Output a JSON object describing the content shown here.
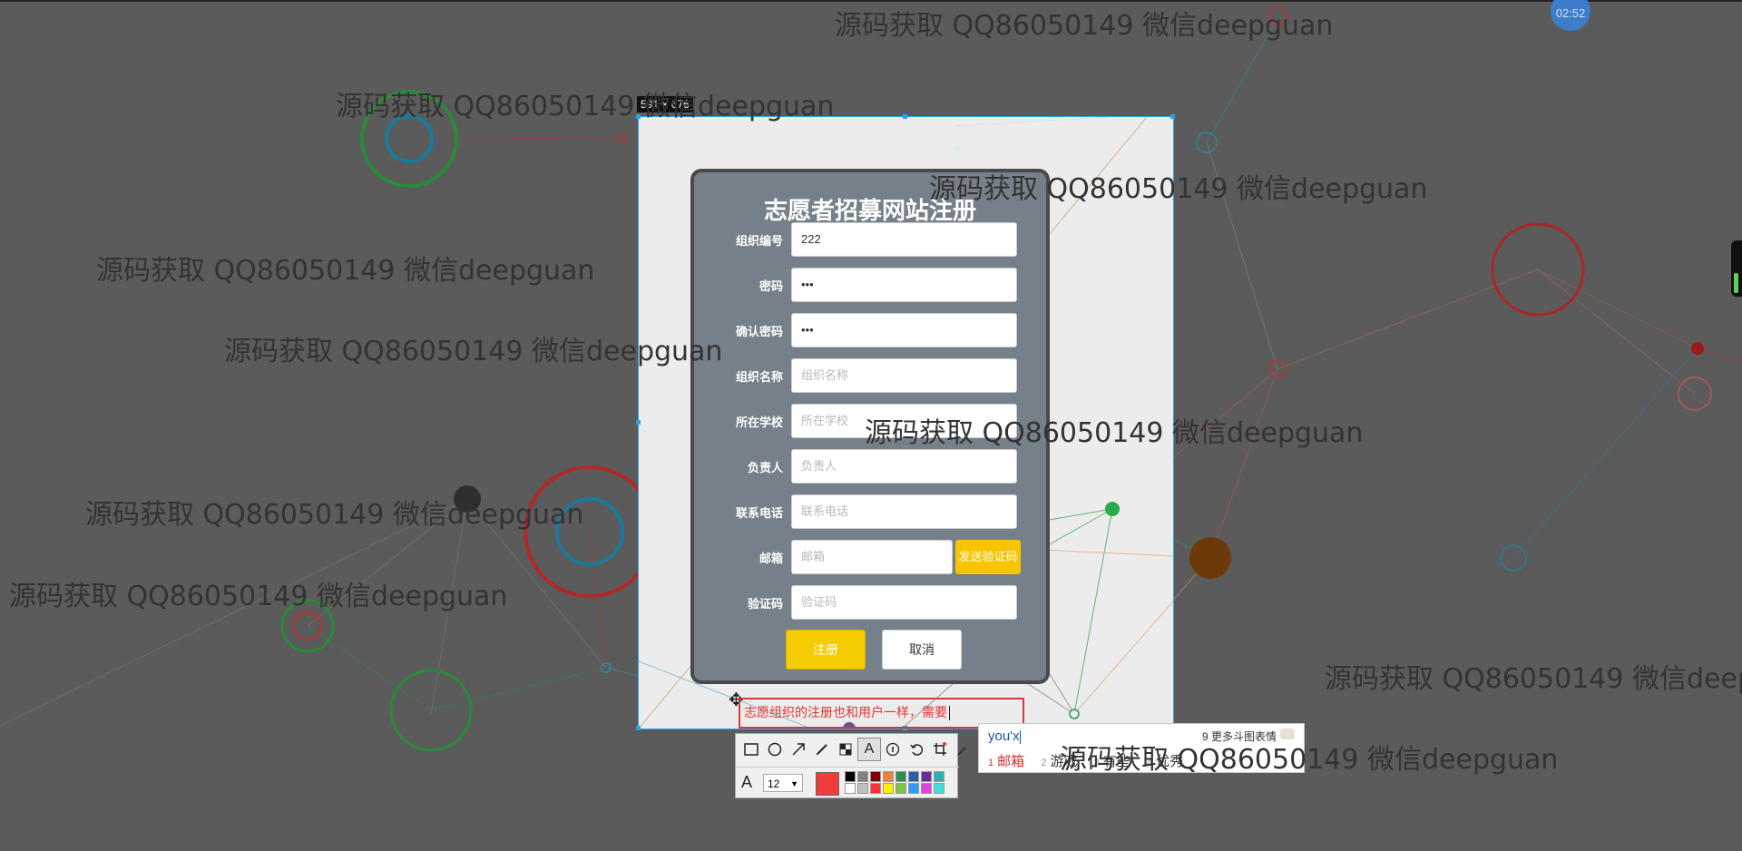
{
  "watermark_text": "源码获取 QQ86050149 微信deepguan",
  "timer": "02:52",
  "capture": {
    "dimensions_label": "591 × 676"
  },
  "form": {
    "title": "志愿者招募网站注册",
    "fields": [
      {
        "label": "组织编号",
        "value": "222",
        "placeholder": ""
      },
      {
        "label": "密码",
        "value": "•••",
        "placeholder": ""
      },
      {
        "label": "确认密码",
        "value": "•••",
        "placeholder": ""
      },
      {
        "label": "组织名称",
        "value": "",
        "placeholder": "组织名称"
      },
      {
        "label": "所在学校",
        "value": "",
        "placeholder": "所在学校"
      },
      {
        "label": "负责人",
        "value": "",
        "placeholder": "负责人"
      },
      {
        "label": "联系电话",
        "value": "",
        "placeholder": "联系电话"
      },
      {
        "label": "邮箱",
        "value": "",
        "placeholder": "邮箱"
      },
      {
        "label": "验证码",
        "value": "",
        "placeholder": "验证码"
      }
    ],
    "send_code_label": "发送验证码",
    "register_label": "注册",
    "cancel_label": "取消"
  },
  "annotation": {
    "text": "志愿组织的注册也和用户一样，需要"
  },
  "toolbar": {
    "tools": [
      "rectangle-icon",
      "ellipse-icon",
      "arrow-icon",
      "pen-icon",
      "mosaic-icon",
      "text-icon",
      "number-icon",
      "undo-icon",
      "crop-icon",
      "pin-icon"
    ],
    "font_size": "12",
    "current_color": "#f03c3c",
    "palette": [
      "#000000",
      "#808080",
      "#800000",
      "#f08040",
      "#2e8b57",
      "#2c5ea8",
      "#6a2c9c",
      "#2ab0b0",
      "#ffffff",
      "#c0c0c0",
      "#ff3333",
      "#ffee00",
      "#7cc244",
      "#3399ff",
      "#dd44dd",
      "#44dddd"
    ]
  },
  "ime": {
    "input": "you'x",
    "more": "9 更多斗图表情",
    "candidates": [
      {
        "num": "1",
        "text": "邮箱"
      },
      {
        "num": "2",
        "text": "游戏"
      },
      {
        "num": "3",
        "text": "有些"
      },
      {
        "num": "4",
        "text": "优秀"
      }
    ]
  }
}
